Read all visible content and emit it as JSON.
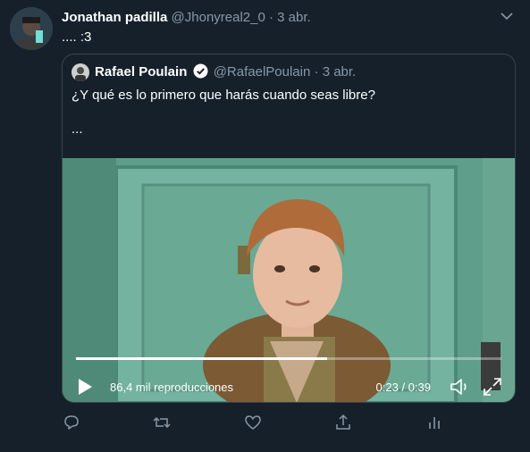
{
  "author": {
    "name": "Jonathan padilla",
    "handle": "@Jhonyreal2_0",
    "separator": "·",
    "date": "3 abr."
  },
  "tweet_text": ".... :3",
  "quoted": {
    "name": "Rafael Poulain",
    "handle": "@RafaelPoulain",
    "separator": "·",
    "date": "3 abr.",
    "text_line1": "¿Y qué es lo primero que harás cuando seas libre?",
    "text_line2": "...",
    "video": {
      "views": "86,4 mil reproducciones",
      "time": "0:23 / 0:39",
      "progress": 0.59
    }
  },
  "icons": {
    "caret": "chevron-down-icon",
    "verified": "verified-badge-icon",
    "play": "play-icon",
    "volume": "volume-icon",
    "fullscreen": "fullscreen-icon",
    "reply": "reply-icon",
    "retweet": "retweet-icon",
    "like": "heart-icon",
    "share": "share-icon",
    "analytics": "analytics-icon"
  },
  "colors": {
    "background": "#15202b",
    "muted": "#8899a6",
    "border": "#38444d",
    "verified": "#ffffff"
  }
}
